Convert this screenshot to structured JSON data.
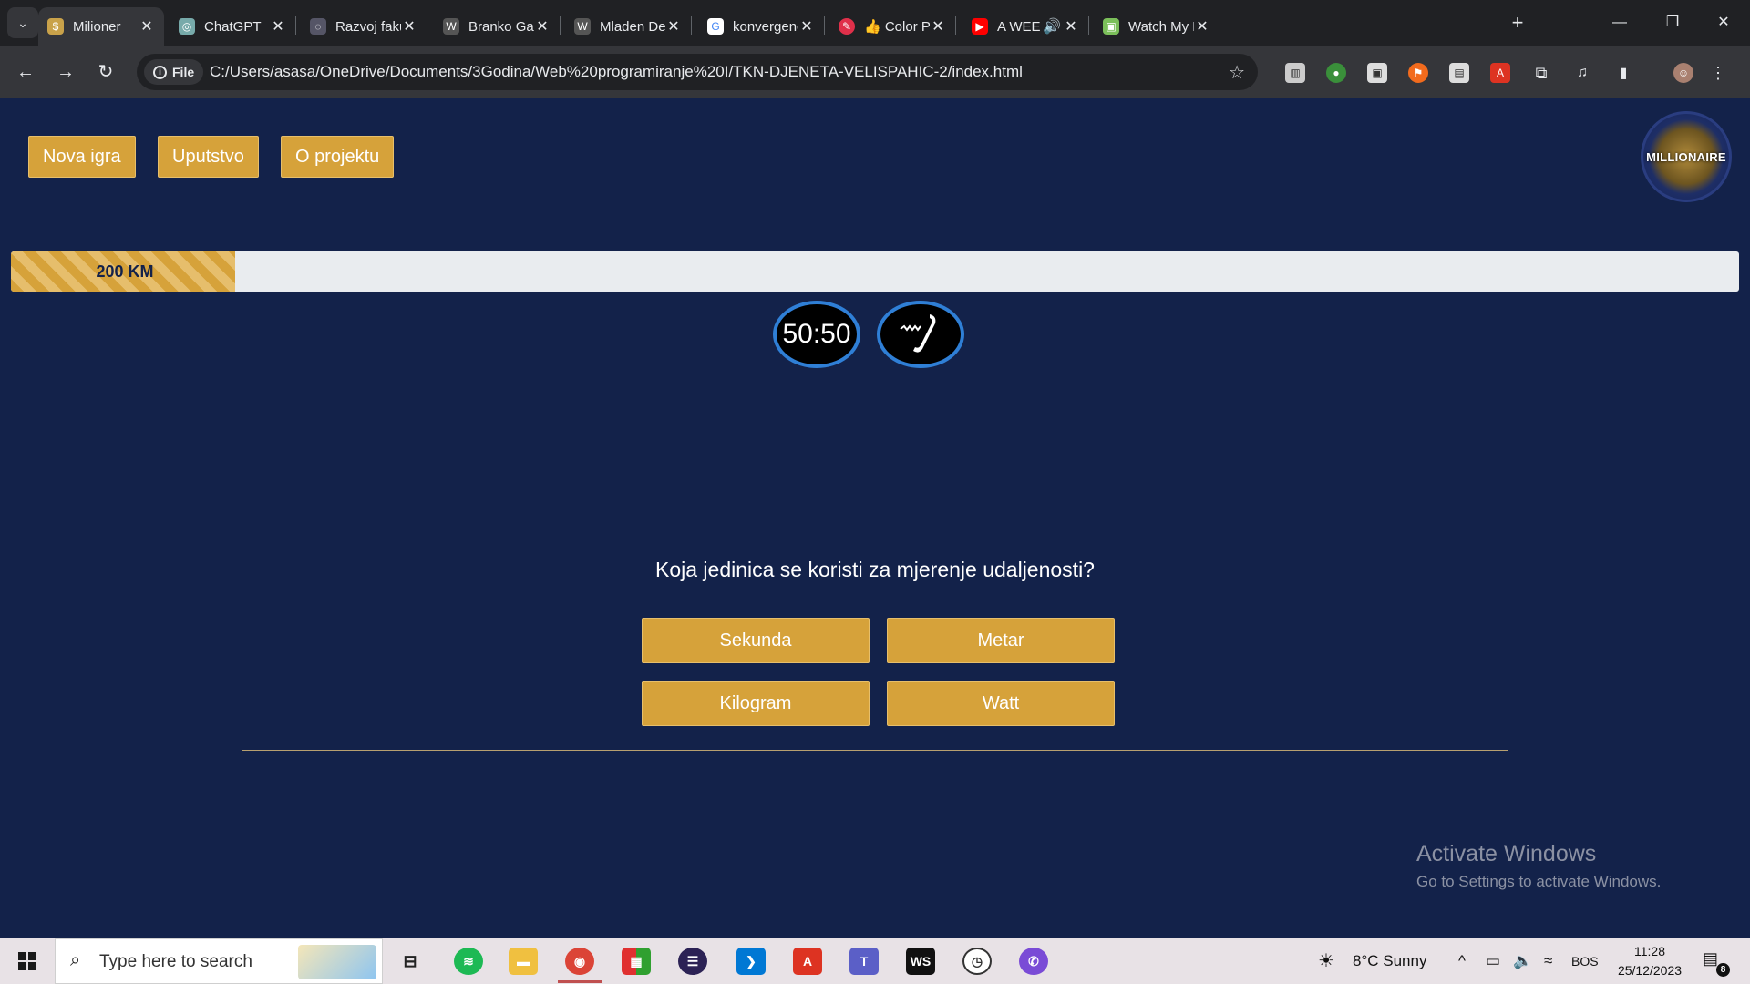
{
  "browser": {
    "tabs": [
      {
        "title": "Milioner",
        "active": true,
        "icon": "money-bag-icon"
      },
      {
        "title": "ChatGPT",
        "icon": "chatgpt-icon"
      },
      {
        "title": "Razvoj fakulte",
        "icon": "site-icon"
      },
      {
        "title": "Branko Galeb",
        "icon": "wordpress-icon"
      },
      {
        "title": "Mladen Deže",
        "icon": "wordpress-icon"
      },
      {
        "title": "konvergencija",
        "icon": "google-icon"
      },
      {
        "title": "👍 Color Pick",
        "icon": "color-picker-icon"
      },
      {
        "title": "A WEEKEN",
        "icon": "youtube-icon"
      },
      {
        "title": "Watch My Mo",
        "icon": "site-icon"
      }
    ],
    "address_chip": "File",
    "url": "C:/Users/asasa/OneDrive/Documents/3Godina/Web%20programiranje%20I/TKN-DJENETA-VELISPAHIC-2/index.html"
  },
  "page": {
    "menu": {
      "new_game": "Nova igra",
      "instructions": "Uputstvo",
      "about": "O projektu"
    },
    "logo_text": "MILLIONAIRE",
    "prize": {
      "label": "200 KM",
      "progress_fraction": 0.13
    },
    "lifelines": {
      "fifty_fifty": "50:50",
      "phone_icon": "phone-icon"
    },
    "question": "Koja jedinica se koristi za mjerenje udaljenosti?",
    "answers": [
      "Sekunda",
      "Metar",
      "Kilogram",
      "Watt"
    ],
    "watermark": {
      "title": "Activate Windows",
      "subtitle": "Go to Settings to activate Windows."
    }
  },
  "taskbar": {
    "search_placeholder": "Type here to search",
    "weather": "8°C  Sunny",
    "language": "BOS",
    "time": "11:28",
    "date": "25/12/2023",
    "notification_count": "8"
  },
  "colors": {
    "page_bg": "#13224a",
    "gold": "#d6a23a",
    "lifeline_ring": "#2f7fd6"
  }
}
